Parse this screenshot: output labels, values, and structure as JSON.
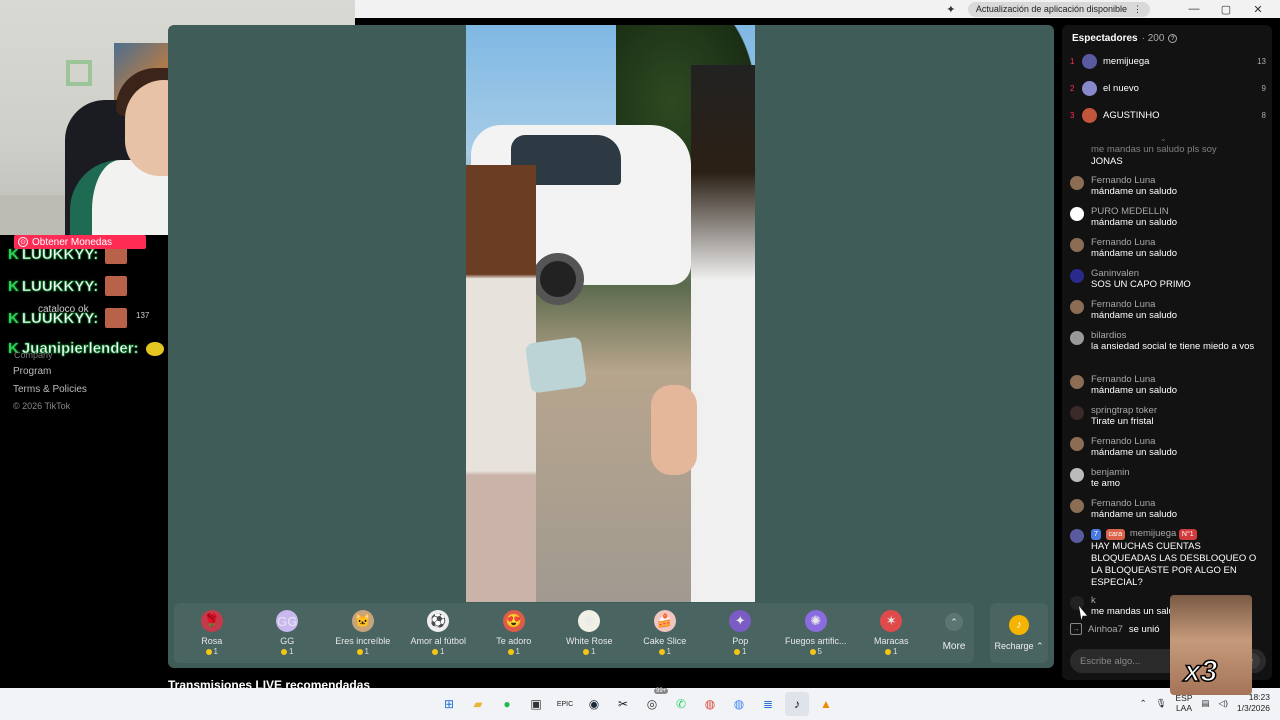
{
  "browser": {
    "update_label": "Actualización de aplicación disponible",
    "update_menu": "⋮",
    "extension_icon": "puzzle-icon",
    "window_controls": [
      "—",
      "▢",
      "✕"
    ]
  },
  "overlay": {
    "get_coins_label": "Obtener Monedas",
    "chat_names": [
      "LUUKKYY:",
      "LUUKKYY:",
      "LUUKKYY:",
      "Juanipierlender:"
    ],
    "mini_name": "cataloco ok",
    "mini_count": "137",
    "mini_partial": "Company"
  },
  "sidebar_footer": {
    "links": [
      "Program",
      "Terms & Policies"
    ],
    "copyright": "© 2026 TikTok"
  },
  "gifts": [
    {
      "name": "Rosa",
      "cost": "1",
      "icon": "rose-icon",
      "glyph": "🌹",
      "color": "#c43a4a"
    },
    {
      "name": "GG",
      "cost": "1",
      "icon": "gg-icon",
      "glyph": "GG",
      "color": "#c9b7f0"
    },
    {
      "name": "Eres increíble",
      "cost": "1",
      "icon": "cat-icon",
      "glyph": "🐱",
      "color": "#c9a37a"
    },
    {
      "name": "Amor al fútbol",
      "cost": "1",
      "icon": "soccer-ball-icon",
      "glyph": "⚽",
      "color": "#eeeeee"
    },
    {
      "name": "Te adoro",
      "cost": "1",
      "icon": "heart-face-icon",
      "glyph": "😍",
      "color": "#e05a4a"
    },
    {
      "name": "White Rose",
      "cost": "1",
      "icon": "white-rose-icon",
      "glyph": "❀",
      "color": "#f0f0e6"
    },
    {
      "name": "Cake Slice",
      "cost": "1",
      "icon": "cake-icon",
      "glyph": "🍰",
      "color": "#f2c6c0"
    },
    {
      "name": "Pop",
      "cost": "1",
      "icon": "pop-icon",
      "glyph": "✦",
      "color": "#7b5cc4"
    },
    {
      "name": "Fuegos artific...",
      "cost": "5",
      "icon": "fireworks-icon",
      "glyph": "✺",
      "color": "#8a6be0"
    },
    {
      "name": "Maracas",
      "cost": "1",
      "icon": "maracas-icon",
      "glyph": "✶",
      "color": "#e04a4a"
    }
  ],
  "more_label": "More",
  "more_icon": "chevron-up-icon",
  "recharge_label": "Recharge ⌃",
  "recommended_heading": "Transmisiones LIVE recomendadas",
  "chat": {
    "header_title": "Espectadores",
    "header_count": "· 200",
    "top_viewers": [
      {
        "rank": "1",
        "name": "memijuega",
        "score": "13",
        "color": "#5a5aa0"
      },
      {
        "rank": "2",
        "name": "el nuevo",
        "score": "9",
        "color": "#8888cc"
      },
      {
        "rank": "3",
        "name": "AGUSTINHO",
        "score": "8",
        "color": "#c2553a"
      }
    ],
    "partial_message": "me mandas un saludo pls soy",
    "messages": [
      {
        "user": "",
        "text": "JONAS",
        "color": ""
      },
      {
        "user": "Fernando Luna",
        "text": "mándame un saludo",
        "color": "#8a6d52"
      },
      {
        "user": "PURO MEDELLIN",
        "text": "mándame un saludo",
        "color": "#ffffff"
      },
      {
        "user": "Fernando Luna",
        "text": "mándame un saludo",
        "color": "#8a6d52"
      },
      {
        "user": "Ganinvalen",
        "text": "SOS UN CAPO PRIMO",
        "color": "#2a2a8a"
      },
      {
        "user": "Fernando Luna",
        "text": "mándame un saludo",
        "color": "#8a6d52"
      },
      {
        "user": "bilardios",
        "text": "la ansiedad social te tiene miedo a vos",
        "color": "#999999"
      },
      {
        "user": "Fernando Luna",
        "text": "mándame un saludo",
        "color": "#8a6d52"
      },
      {
        "user": "springtrap toker",
        "text": "Tirate un fristal",
        "color": "#3a2a2a"
      },
      {
        "user": "Fernando Luna",
        "text": "mándame un saludo",
        "color": "#8a6d52"
      },
      {
        "user": "benjamin",
        "text": "te amo",
        "color": "#bbbbbb"
      },
      {
        "user": "Fernando Luna",
        "text": "mándame un saludo",
        "color": "#8a6d52"
      }
    ],
    "highlight": {
      "badges": [
        "7",
        "cara",
        "N°1"
      ],
      "user": "memijuega",
      "text": "HAY MUCHAS CUENTAS BLOQUEADAS LAS DESBLOQUEO O LA BLOQUEASTE POR ALGO EN ESPECIAL?"
    },
    "last_message": {
      "user": "k",
      "text": "me mandas un salu"
    },
    "joined": {
      "user": "Ainhoa7",
      "text": "se unió"
    },
    "input_placeholder": "Escribe algo...",
    "overlay_multiplier": "x3"
  },
  "taskbar": {
    "apps": [
      {
        "icon": "windows-start-icon",
        "glyph": "⊞",
        "color": "#1e6fd9"
      },
      {
        "icon": "file-explorer-icon",
        "glyph": "▰",
        "color": "#e8b43a"
      },
      {
        "icon": "spotify-icon",
        "glyph": "●",
        "color": "#1db954"
      },
      {
        "icon": "store-icon",
        "glyph": "▣",
        "color": "#333333"
      },
      {
        "icon": "epic-games-icon",
        "glyph": "EPIC",
        "color": "#222222"
      },
      {
        "icon": "steam-icon",
        "glyph": "◉",
        "color": "#1b2838"
      },
      {
        "icon": "capcut-icon",
        "glyph": "✂",
        "color": "#111111"
      },
      {
        "icon": "obs-icon",
        "glyph": "◎",
        "color": "#333333"
      },
      {
        "icon": "whatsapp-icon",
        "glyph": "✆",
        "color": "#25d366"
      },
      {
        "icon": "chrome-icon",
        "glyph": "◍",
        "color": "#db4437"
      },
      {
        "icon": "chrome-profile-icon",
        "glyph": "◍",
        "color": "#4285f4"
      },
      {
        "icon": "notepad-icon",
        "glyph": "≣",
        "color": "#2a6fd6"
      },
      {
        "icon": "tiktok-icon",
        "glyph": "♪",
        "color": "#111111"
      },
      {
        "icon": "vlc-icon",
        "glyph": "▲",
        "color": "#f08a00"
      }
    ],
    "whatsapp_badge": "99+",
    "tray_chevron": "⌃",
    "lang_top": "ESP",
    "lang_bottom": "LAA",
    "time": "18:23",
    "date": "1/3/2026"
  }
}
